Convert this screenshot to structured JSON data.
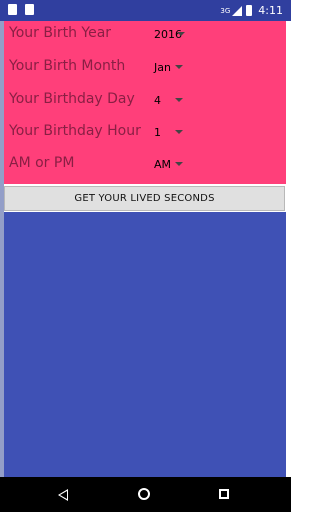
{
  "status_bar": {
    "time": "4:11",
    "network": "3G",
    "icons": [
      "sim-icon",
      "notification-icon",
      "signal-icon",
      "battery-icon"
    ]
  },
  "form": {
    "fields": [
      {
        "label": "Your Birth Year",
        "value": "2016"
      },
      {
        "label": "Your Birth Month",
        "value": "Jan"
      },
      {
        "label": "Your Birthday Day",
        "value": "4"
      },
      {
        "label": "Your Birthday Hour",
        "value": "1"
      },
      {
        "label": "AM or PM",
        "value": "AM"
      }
    ]
  },
  "action": {
    "button_label": "GET YOUR LIVED SECONDS"
  },
  "colors": {
    "pink": "#ff3f7a",
    "blue": "#3f51b5",
    "status_bar": "#303f9f"
  }
}
